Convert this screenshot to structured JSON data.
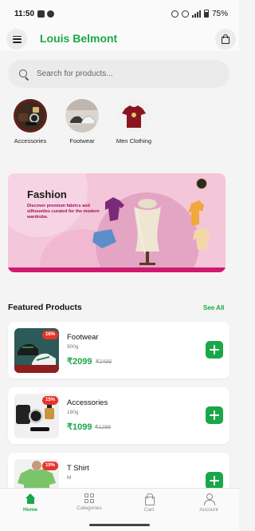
{
  "status_bar": {
    "time": "11:50",
    "battery": "75%"
  },
  "header": {
    "title": "Louis Belmont"
  },
  "search": {
    "placeholder": "Search for products..."
  },
  "categories": [
    {
      "label": "Accessories"
    },
    {
      "label": "Footwear"
    },
    {
      "label": "Men Clothing"
    }
  ],
  "banner": {
    "title": "Fashion",
    "text": "Discover premium fabrics and silhouettes curated for the modern wardrobe."
  },
  "featured": {
    "title": "Featured Products",
    "see_all": "See All",
    "products": [
      {
        "badge": "16%",
        "name": "Footwear",
        "weight": "900g",
        "price": "₹2099",
        "old_price": "₹2499"
      },
      {
        "badge": "15%",
        "name": "Accessories",
        "weight": "180g",
        "price": "₹1099",
        "old_price": "₹1299"
      },
      {
        "badge": "10%",
        "name": "T Shirt",
        "weight": "M",
        "price": "",
        "old_price": ""
      }
    ]
  },
  "nav": {
    "items": [
      {
        "label": "Home",
        "active": true
      },
      {
        "label": "Categories"
      },
      {
        "label": "Cart"
      },
      {
        "label": "Account"
      }
    ]
  },
  "colors": {
    "accent": "#1aa748",
    "badge": "#e8342b",
    "banner": "#f4c6da"
  }
}
